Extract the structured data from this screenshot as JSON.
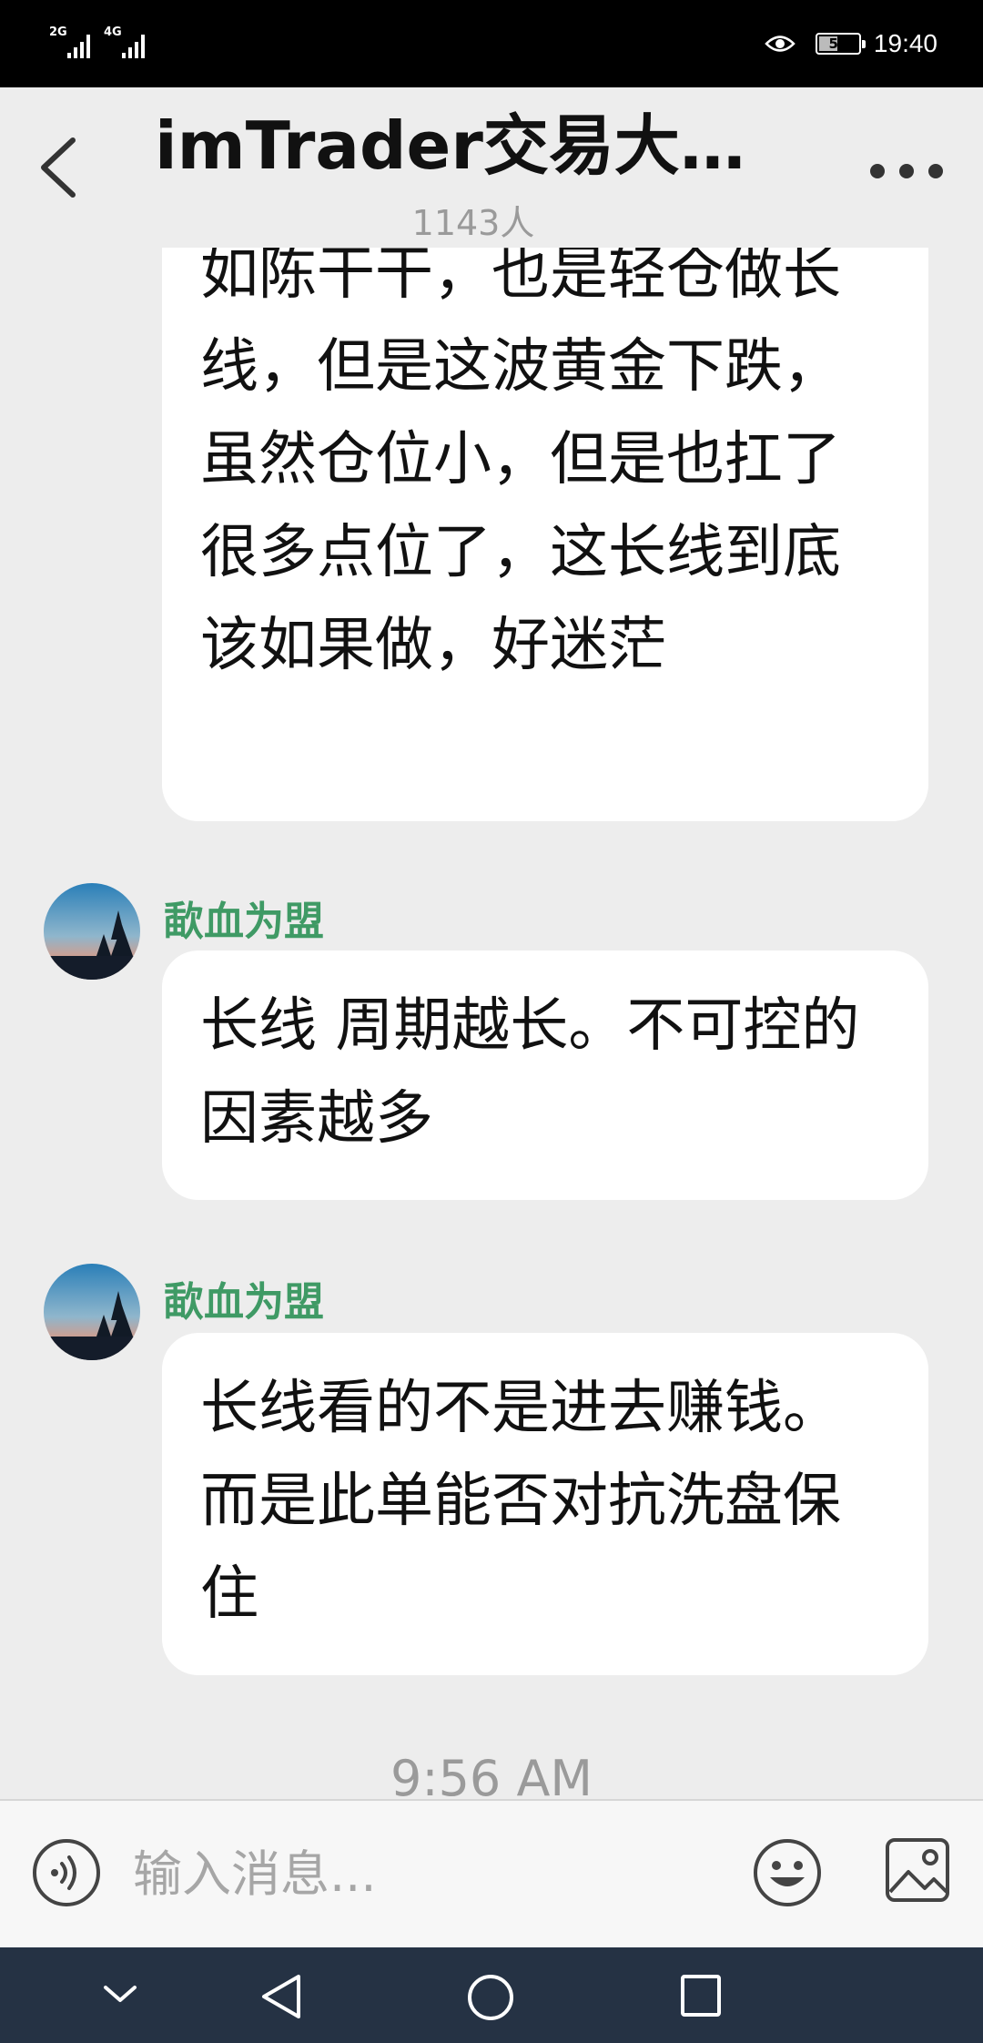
{
  "status_bar": {
    "network_1": "2G",
    "network_2": "4G",
    "battery_level": "50",
    "time": "19:40"
  },
  "header": {
    "title": "imTrader交易大赛...",
    "member_count": "1143人"
  },
  "messages": [
    {
      "sender": "",
      "text": "如陈干干，也是轻仓做长线，但是这波黄金下跌，虽然仓位小，但是也扛了很多点位了，这长线到底该如果做，好迷茫"
    },
    {
      "sender": "歃血为盟",
      "text": "长线 周期越长。不可控的因素越多"
    },
    {
      "sender": "歃血为盟",
      "text": "长线看的不是进去赚钱。而是此单能否对抗洗盘保住"
    }
  ],
  "time_divider": "9:56 AM",
  "input_bar": {
    "placeholder": "输入消息...",
    "value": ""
  },
  "colors": {
    "sender_name": "#3f9a65",
    "background": "#ededed",
    "nav_bar": "#253244"
  },
  "icons": [
    "back-arrow-icon",
    "more-dots-icon",
    "voice-icon",
    "emoji-icon",
    "image-icon",
    "nav-down-icon",
    "nav-back-icon",
    "nav-home-icon",
    "nav-recent-icon"
  ]
}
